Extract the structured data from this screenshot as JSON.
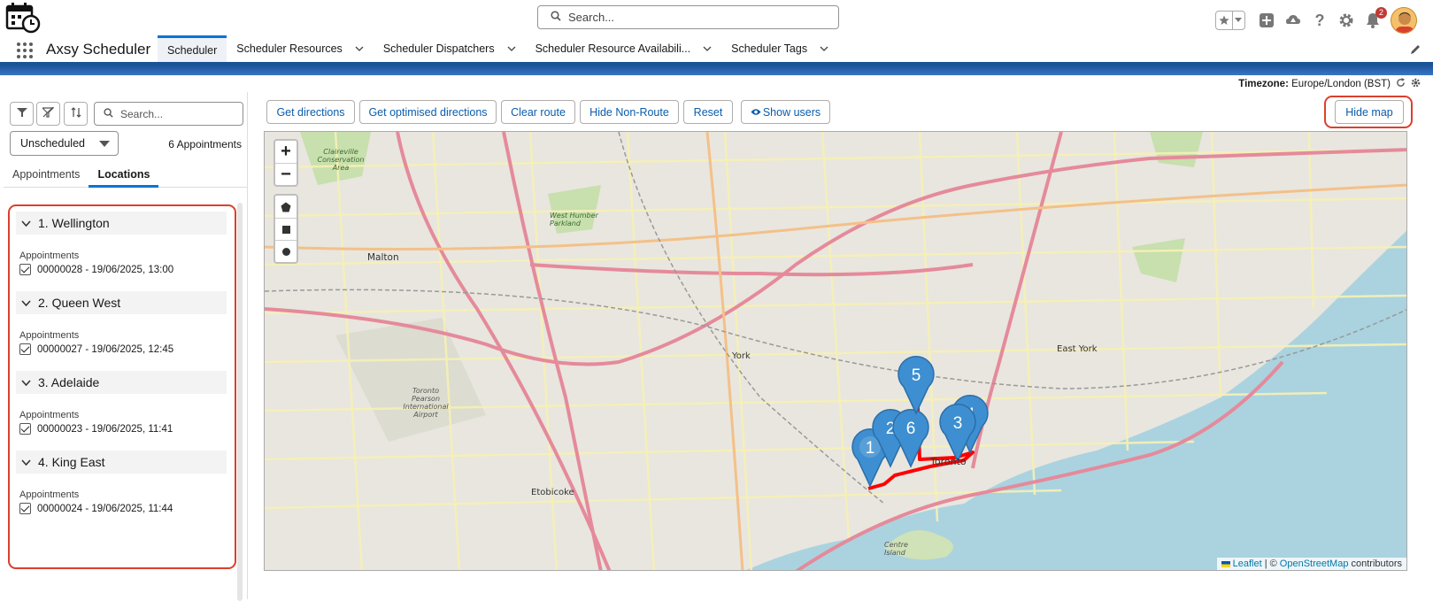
{
  "header": {
    "search_placeholder": "Search...",
    "notification_count": "2"
  },
  "nav": {
    "app_name": "Axsy Scheduler",
    "tabs": [
      {
        "label": "Scheduler",
        "active": true
      },
      {
        "label": "Scheduler Resources"
      },
      {
        "label": "Scheduler Dispatchers"
      },
      {
        "label": "Scheduler Resource Availabili..."
      },
      {
        "label": "Scheduler Tags"
      }
    ]
  },
  "timezone": {
    "label": "Timezone:",
    "value": "Europe/London (BST)"
  },
  "left_panel": {
    "search_placeholder": "Search...",
    "status_filter": "Unscheduled",
    "count": "6 Appointments",
    "tabs": [
      "Appointments",
      "Locations"
    ],
    "active_tab": "Locations",
    "locations": [
      {
        "title": "1. Wellington",
        "sub": "Appointments",
        "item": "00000028 - 19/06/2025, 13:00"
      },
      {
        "title": "2. Queen West",
        "sub": "Appointments",
        "item": "00000027 - 19/06/2025, 12:45"
      },
      {
        "title": "3. Adelaide",
        "sub": "Appointments",
        "item": "00000023 - 19/06/2025, 11:41"
      },
      {
        "title": "4. King East",
        "sub": "Appointments",
        "item": "00000024 - 19/06/2025, 11:44"
      }
    ]
  },
  "toolbar": {
    "get_directions": "Get directions",
    "get_optimised": "Get optimised directions",
    "clear_route": "Clear route",
    "hide_non_route": "Hide Non-Route",
    "reset": "Reset",
    "show_users": "Show users",
    "hide_map": "Hide map"
  },
  "map": {
    "labels": {
      "malton": "Malton",
      "york": "York",
      "east_york": "East York",
      "etobicoke": "Etobicoke",
      "toronto": "Toronto",
      "pearson": "Toronto Pearson International Airport",
      "west_humber": "West Humber Parkland",
      "claireville": "Claireville Conservation Area",
      "centre_island": "Centre Island"
    },
    "markers": [
      "1",
      "2",
      "3",
      "4",
      "5",
      "6"
    ],
    "attribution": {
      "leaflet": "Leaflet",
      "sep": "| ©",
      "osm": "OpenStreetMap",
      "suffix": "contributors"
    },
    "route_color": "#ff0000",
    "marker_color": "#3d8fd1"
  }
}
